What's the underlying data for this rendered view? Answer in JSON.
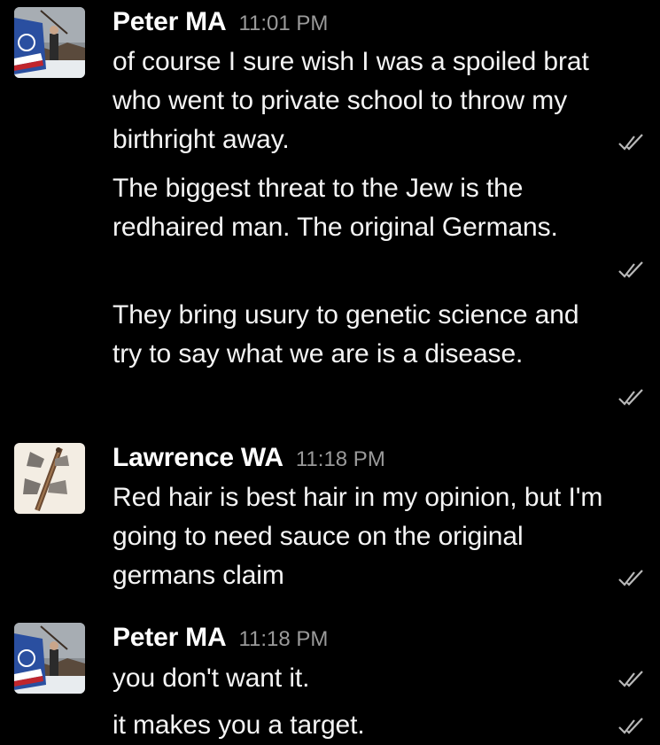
{
  "colors": {
    "background": "#000000",
    "text": "#f4f4f4",
    "timestamp": "#9a9a9a",
    "read_check": "#b8b8b8"
  },
  "messages": [
    {
      "sender": "Peter MA",
      "time": "11:01 PM",
      "avatar_icon": "flag-avatar-icon",
      "lines": [
        "of course I sure wish I was a spoiled brat who went to private school to throw my birthright away.",
        "The biggest threat to the Jew is the redhaired man. The original Germans.",
        "They bring usury to genetic science and try to say what we are is a disease."
      ]
    },
    {
      "sender": "Lawrence WA",
      "time": "11:18 PM",
      "avatar_icon": "axe-avatar-icon",
      "lines": [
        "Red hair is best hair in my opinion, but I'm going to need sauce on the original germans claim"
      ]
    },
    {
      "sender": "Peter MA",
      "time": "11:18 PM",
      "avatar_icon": "flag-avatar-icon",
      "lines": [
        "you don't want it.",
        "it makes you a target."
      ]
    }
  ]
}
